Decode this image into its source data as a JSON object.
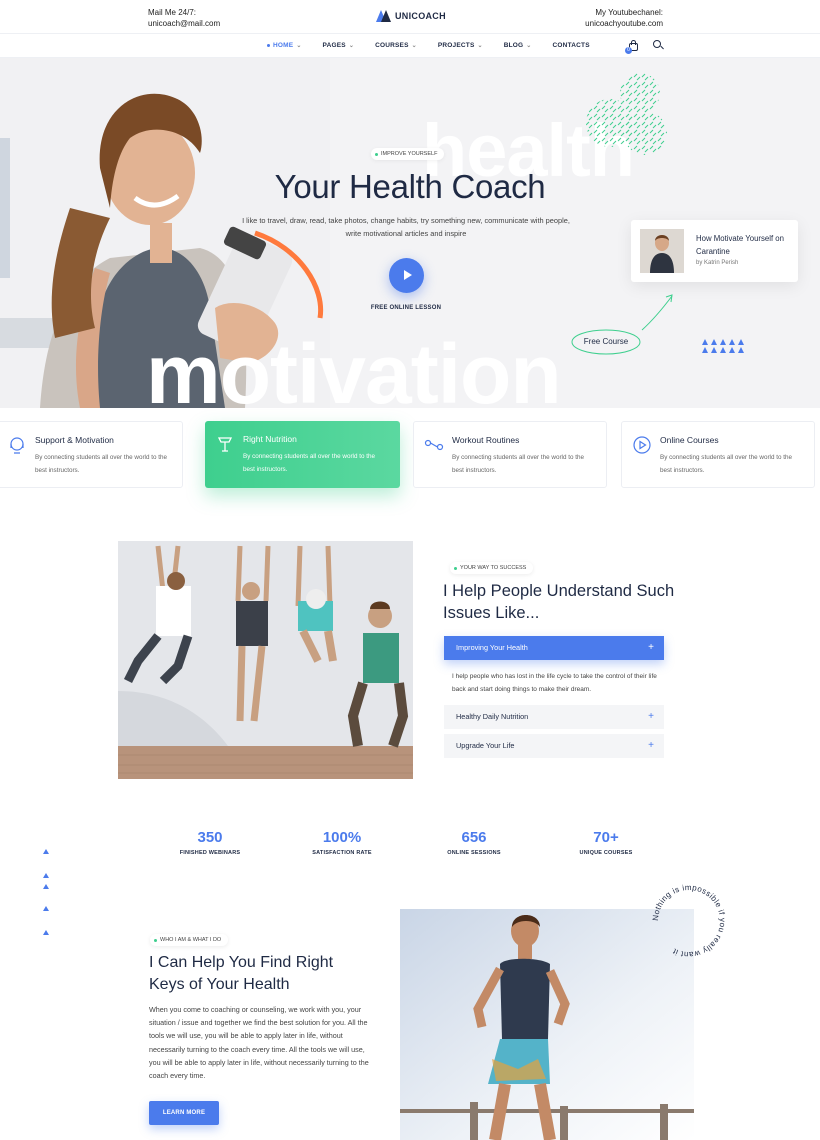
{
  "topbar": {
    "mail_label": "Mail Me 24/7:",
    "mail_value": "unicoach@mail.com",
    "logo_text": "UNICOACH",
    "yt_label": "My Youtubechanel:",
    "yt_value": "unicoachyoutube.com"
  },
  "nav": {
    "items": [
      {
        "label": "HOME"
      },
      {
        "label": "PAGES"
      },
      {
        "label": "COURSES"
      },
      {
        "label": "PROJECTS"
      },
      {
        "label": "BLOG"
      },
      {
        "label": "CONTACTS"
      }
    ],
    "cart_count": "0"
  },
  "hero": {
    "bg_word_top": "health",
    "bg_word_bottom": "motivation",
    "tag": "IMPROVE YOURSELF",
    "title": "Your Health Coach",
    "lead": "I like to travel, draw, read, take photos, change habits, try something new, communicate with people, write motivational articles and inspire",
    "lesson_label": "FREE ONLINE LESSON",
    "card_title": "How Motivate Yourself on Carantine",
    "card_author": "by Katrin Perish",
    "free_course": "Free Course"
  },
  "features": [
    {
      "title": "Support & Motivation",
      "desc": "By connecting students all over the world to the best instructors.",
      "icon": "support-icon"
    },
    {
      "title": "Right Nutrition",
      "desc": "By connecting students all over the world to the best instructors.",
      "icon": "nutrition-icon"
    },
    {
      "title": "Workout Routines",
      "desc": "By connecting students all over the world to the best instructors.",
      "icon": "workout-icon"
    },
    {
      "title": "Online Courses",
      "desc": "By connecting students all over the world to the best instructors.",
      "icon": "play-icon"
    }
  ],
  "help": {
    "tag": "YOUR WAY TO SUCCESS",
    "title": "I Help People Understand Such Issues Like...",
    "accordion": [
      {
        "label": "Improving Your Health",
        "body": "I help people who has lost in the life cycle to take the control of their life back and start doing things to make their dream."
      },
      {
        "label": "Healthy Daily Nutrition"
      },
      {
        "label": "Upgrade Your Life"
      }
    ]
  },
  "stats": [
    {
      "value": "350",
      "label": "FINISHED WEBINARS"
    },
    {
      "value": "100%",
      "label": "SATISFACTION RATE"
    },
    {
      "value": "656",
      "label": "ONLINE SESSIONS"
    },
    {
      "value": "70+",
      "label": "UNIQUE COURSES"
    }
  ],
  "who": {
    "tag": "WHO I AM & WHAT I DO",
    "title": "I Can Help You Find Right Keys of Your Health",
    "text": "When you come to coaching or counseling, we work with you, your situation / issue and together we find the best solution for you. All the tools we will use, you will be able to apply later in life, without necessarily turning to the coach every time. All the tools we will use, you will be able to apply later in life, without necessarily turning to the coach every time.",
    "button": "LEARN MORE",
    "circle_text": "Nothing is impossible if you really want it"
  },
  "colors": {
    "accent": "#4b7bec",
    "green": "#3ecf8e",
    "dark": "#1f2a44"
  }
}
